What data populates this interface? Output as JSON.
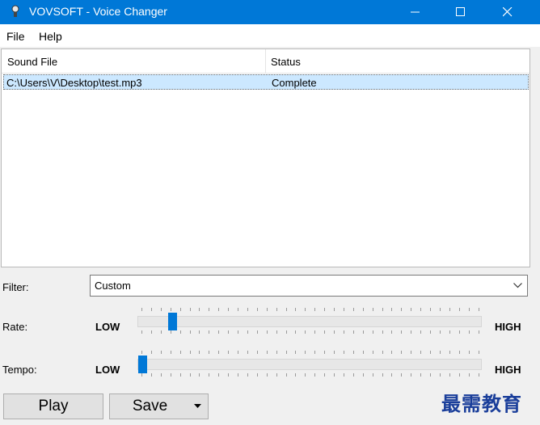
{
  "window": {
    "title": "VOVSOFT - Voice Changer"
  },
  "menu": {
    "items": [
      "File",
      "Help"
    ]
  },
  "list": {
    "columns": [
      "Sound File",
      "Status"
    ],
    "rows": [
      {
        "file": "C:\\Users\\V\\Desktop\\test.mp3",
        "status": "Complete"
      }
    ]
  },
  "filter": {
    "label": "Filter:",
    "value": "Custom"
  },
  "rate": {
    "label": "Rate:",
    "low": "LOW",
    "high": "HIGH",
    "level": 0.09
  },
  "tempo": {
    "label": "Tempo:",
    "low": "LOW",
    "high": "HIGH",
    "level": 0.0
  },
  "buttons": {
    "play": "Play",
    "save": "Save"
  },
  "watermark": "最需教育",
  "colors": {
    "accent": "#0078d7",
    "selection": "#cce8ff"
  }
}
